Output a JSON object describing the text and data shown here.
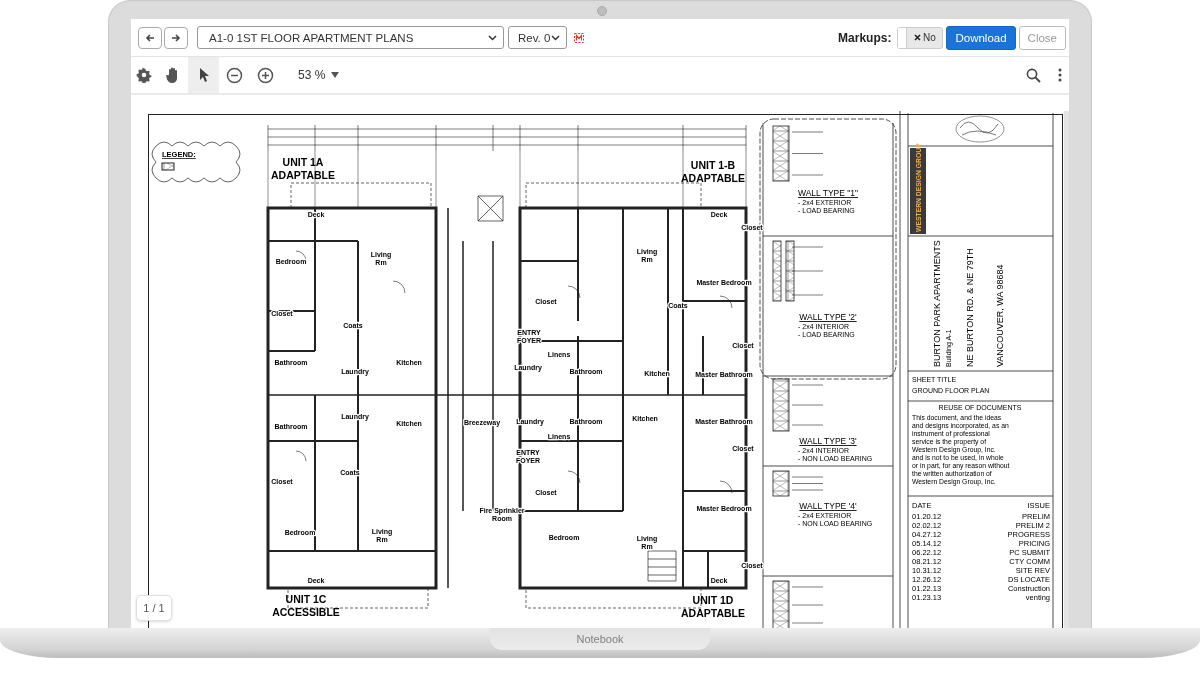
{
  "device": {
    "label": "Notebook"
  },
  "header": {
    "document": "A1-0 1ST FLOOR APARTMENT PLANS",
    "revision": "Rev. 0",
    "markups_label": "Markups:",
    "markups_toggle": {
      "text": "No",
      "on": false
    },
    "buttons": [
      {
        "label": "Download",
        "kind": "primary",
        "disabled": false
      },
      {
        "label": "Close",
        "kind": "secondary",
        "disabled": true
      }
    ]
  },
  "view_toolbar": {
    "tools": [
      {
        "kind": "settings",
        "selected": false
      },
      {
        "kind": "pan",
        "selected": false
      },
      {
        "kind": "select",
        "selected": true
      },
      {
        "kind": "zoom-out",
        "selected": false
      },
      {
        "kind": "zoom-in",
        "selected": false
      }
    ],
    "zoom": "53 %"
  },
  "drawing": {
    "legend": "LEGEND:",
    "units": [
      {
        "title": "UNIT 1A",
        "subtitle": "ADAPTABLE"
      },
      {
        "title": "UNIT 1-B",
        "subtitle": "ADAPTABLE"
      },
      {
        "title": "UNIT 1C",
        "subtitle": "ACCESSIBLE"
      },
      {
        "title": "UNIT 1D",
        "subtitle": "ADAPTABLE"
      }
    ],
    "rooms": [
      {
        "lines": [
          "Deck"
        ]
      },
      {
        "lines": [
          "Bedroom"
        ]
      },
      {
        "lines": [
          "Living",
          "Rm"
        ]
      },
      {
        "lines": [
          "Closet"
        ]
      },
      {
        "lines": [
          "Coats"
        ]
      },
      {
        "lines": [
          "Bathroom"
        ]
      },
      {
        "lines": [
          "Laundry"
        ]
      },
      {
        "lines": [
          "Kitchen"
        ]
      },
      {
        "lines": [
          "Deck"
        ]
      },
      {
        "lines": [
          "Closet"
        ]
      },
      {
        "lines": [
          "Living",
          "Rm"
        ]
      },
      {
        "lines": [
          "Master Bedroom"
        ]
      },
      {
        "lines": [
          "Closet"
        ]
      },
      {
        "lines": [
          "Coats"
        ]
      },
      {
        "lines": [
          "ENTRY",
          "FOYER"
        ]
      },
      {
        "lines": [
          "Linens"
        ]
      },
      {
        "lines": [
          "Closet"
        ]
      },
      {
        "lines": [
          "Laundry"
        ]
      },
      {
        "lines": [
          "Bathroom"
        ]
      },
      {
        "lines": [
          "Kitchen"
        ]
      },
      {
        "lines": [
          "Master Bathroom"
        ]
      },
      {
        "lines": [
          "Bathroom"
        ]
      },
      {
        "lines": [
          "Laundry"
        ]
      },
      {
        "lines": [
          "Kitchen"
        ]
      },
      {
        "lines": [
          "Breezeway"
        ]
      },
      {
        "lines": [
          "Laundry"
        ]
      },
      {
        "lines": [
          "Bathroom"
        ]
      },
      {
        "lines": [
          "Kitchen"
        ]
      },
      {
        "lines": [
          "Master Bathroom"
        ]
      },
      {
        "lines": [
          "Linens"
        ]
      },
      {
        "lines": [
          "ENTRY",
          "FOYER"
        ]
      },
      {
        "lines": [
          "Closet"
        ]
      },
      {
        "lines": [
          "Closet"
        ]
      },
      {
        "lines": [
          "Coats"
        ]
      },
      {
        "lines": [
          "Closet"
        ]
      },
      {
        "lines": [
          "Fire Sprinkler",
          "Room"
        ]
      },
      {
        "lines": [
          "Master Bedroom"
        ]
      },
      {
        "lines": [
          "Bedroom"
        ]
      },
      {
        "lines": [
          "Living",
          "Rm"
        ]
      },
      {
        "lines": [
          "Bedroom"
        ]
      },
      {
        "lines": [
          "Living",
          "Rm"
        ]
      },
      {
        "lines": [
          "Closet"
        ]
      },
      {
        "lines": [
          "Deck"
        ]
      },
      {
        "lines": [
          "Deck"
        ]
      }
    ],
    "wall_types": [
      {
        "title": "WALL TYPE \"1\"",
        "notes": [
          "- 2x4 EXTERIOR",
          "- LOAD BEARING"
        ]
      },
      {
        "title": "WALL TYPE '2'",
        "notes": [
          "- 2x4 INTERIOR",
          "- LOAD BEARING"
        ]
      },
      {
        "title": "WALL TYPE '3'",
        "notes": [
          "- 2x4 INTERIOR",
          "- NON LOAD BEARING"
        ]
      },
      {
        "title": "WALL TYPE '4'",
        "notes": [
          "- 2x4 EXTERIOR",
          "- NON LOAD BEARING"
        ]
      }
    ],
    "title_block": {
      "firm": "WESTERN DESIGN GROUP",
      "project": "BURTON PARK APARTMENTS",
      "building": "Building A-1",
      "street": "NE BURTON RD. & NE 79TH",
      "city": "VANCOUVER, WA 98684",
      "sheet_title_label": "SHEET TITLE",
      "sheet_title": "GROUND FLOOR PLAN",
      "reuse_title": "REUSE OF DOCUMENTS",
      "reuse_text": [
        "This document, and the ideas",
        "and designs incorporated, as an",
        "instrument of professional",
        "service is the property of",
        "Western Design Group, Inc.",
        "and is not to be used, in whole",
        "or in part, for any reason without",
        "the written authorization of",
        "Western Design Group, Inc."
      ],
      "issues_header": [
        "DATE",
        "ISSUE"
      ],
      "issues": [
        {
          "date": "01.20.12",
          "issue": "PRELIM"
        },
        {
          "date": "02.02.12",
          "issue": "PRELIM 2"
        },
        {
          "date": "04.27.12",
          "issue": "PROGRESS"
        },
        {
          "date": "05.14.12",
          "issue": "PRICING"
        },
        {
          "date": "06.22.12",
          "issue": "PC SUBMIT"
        },
        {
          "date": "08.21.12",
          "issue": "CTY COMM"
        },
        {
          "date": "10.31.12",
          "issue": "SITE REV"
        },
        {
          "date": "12.26.12",
          "issue": "DS LOCATE"
        },
        {
          "date": "01.22.13",
          "issue": "Construction"
        },
        {
          "date": "01.23.13",
          "issue": "venting"
        }
      ]
    }
  },
  "page_indicator": "1 / 1"
}
